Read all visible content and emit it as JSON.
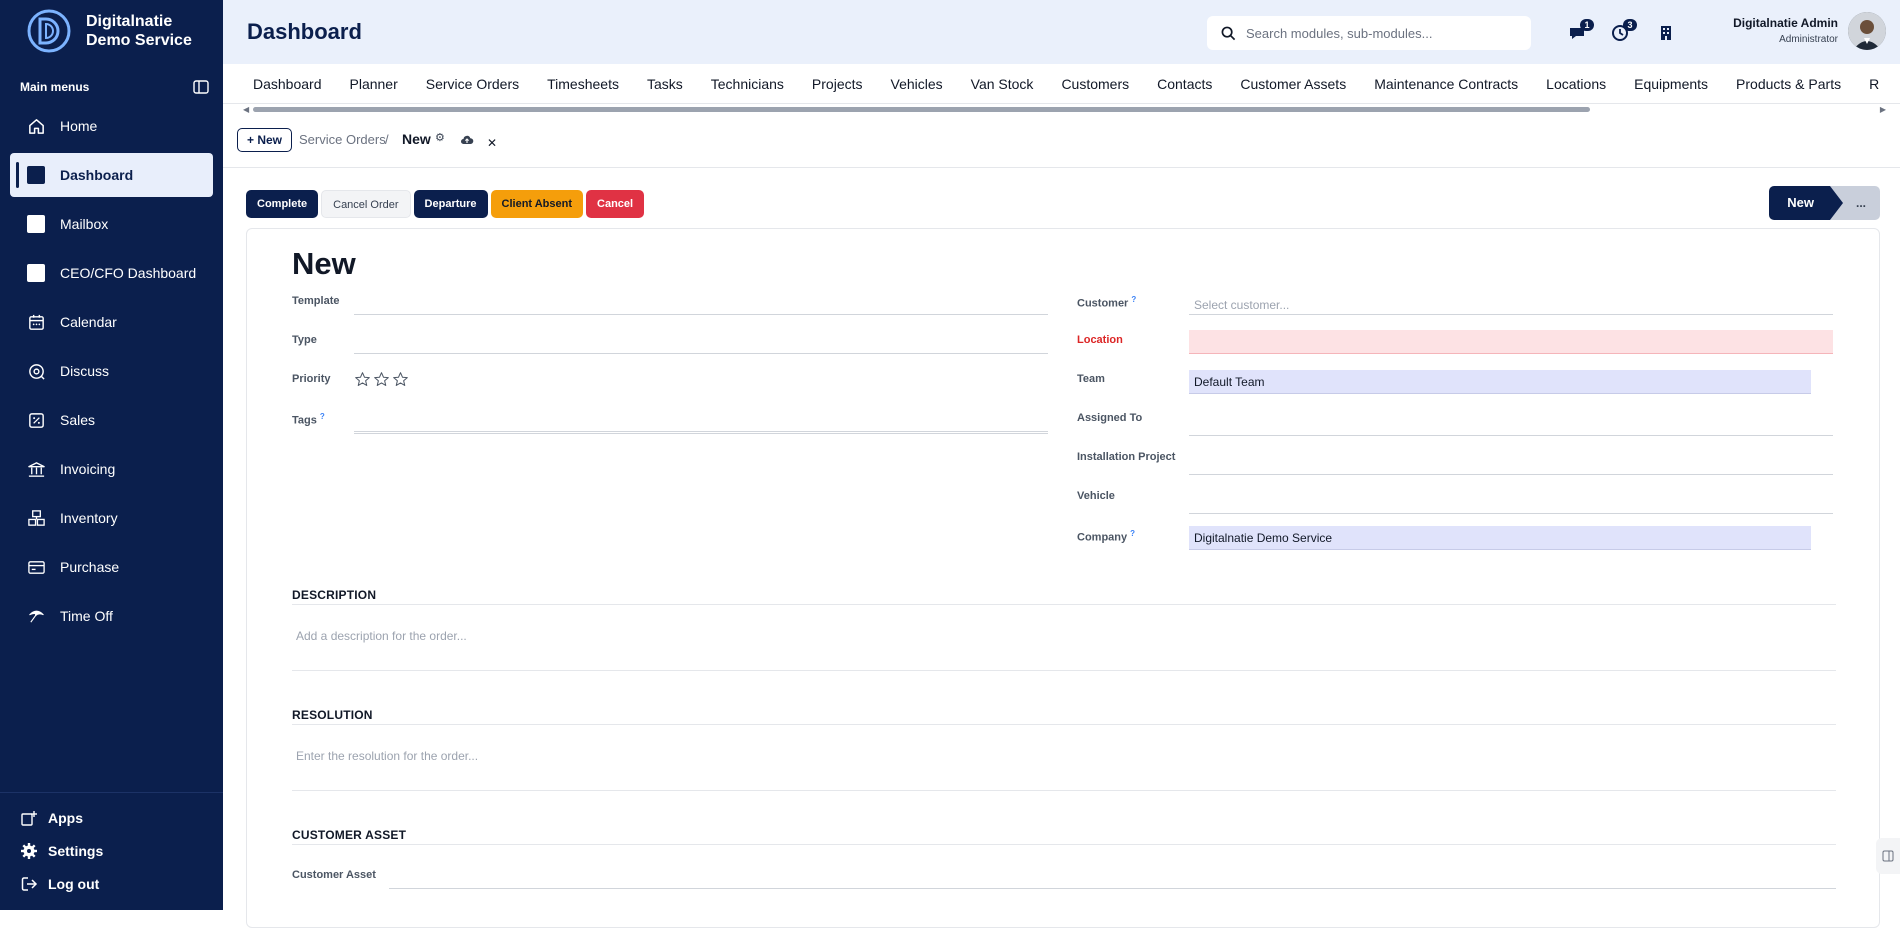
{
  "app": {
    "name": "Digitalnatie Demo Service"
  },
  "sidebar": {
    "menu_heading": "Main menus",
    "items": [
      {
        "label": "Home",
        "icon": "home-icon"
      },
      {
        "label": "Dashboard",
        "icon": "square-icon",
        "active": true
      },
      {
        "label": "Mailbox",
        "icon": "square-icon"
      },
      {
        "label": "CEO/CFO Dashboard",
        "icon": "square-icon"
      },
      {
        "label": "Calendar",
        "icon": "calendar-icon"
      },
      {
        "label": "Discuss",
        "icon": "discuss-icon"
      },
      {
        "label": "Sales",
        "icon": "sales-icon"
      },
      {
        "label": "Invoicing",
        "icon": "bank-icon"
      },
      {
        "label": "Inventory",
        "icon": "inventory-icon"
      },
      {
        "label": "Purchase",
        "icon": "card-icon"
      },
      {
        "label": "Time Off",
        "icon": "time-off-icon"
      }
    ],
    "bottom": [
      {
        "label": "Apps",
        "icon": "apps-icon"
      },
      {
        "label": "Settings",
        "icon": "gear-icon"
      },
      {
        "label": "Log out",
        "icon": "logout-icon"
      }
    ]
  },
  "header": {
    "title": "Dashboard",
    "search_placeholder": "Search modules, sub-modules...",
    "messages_count": "1",
    "activities_count": "3",
    "user_name": "Digitalnatie Admin",
    "user_role": "Administrator"
  },
  "tabs": [
    "Dashboard",
    "Planner",
    "Service Orders",
    "Timesheets",
    "Tasks",
    "Technicians",
    "Projects",
    "Vehicles",
    "Van Stock",
    "Customers",
    "Contacts",
    "Customer Assets",
    "Maintenance Contracts",
    "Locations",
    "Equipments",
    "Products & Parts",
    "R"
  ],
  "breadcrumb": {
    "new_button": "+ New",
    "parent": "Service Orders",
    "separator": "/",
    "current": "New"
  },
  "actions": {
    "complete": "Complete",
    "cancel_order": "Cancel Order",
    "departure": "Departure",
    "client_absent": "Client Absent",
    "cancel": "Cancel"
  },
  "statusbar": {
    "current": "New",
    "more": "..."
  },
  "form": {
    "title": "New",
    "left": {
      "template_label": "Template",
      "type_label": "Type",
      "priority_label": "Priority",
      "priority_stars": 0,
      "priority_max": 3,
      "tags_label": "Tags",
      "tags_help": "?"
    },
    "right": {
      "customer_label": "Customer",
      "customer_help": "?",
      "customer_placeholder": "Select customer...",
      "location_label": "Location",
      "team_label": "Team",
      "team_value": "Default Team",
      "assigned_label": "Assigned To",
      "project_label": "Installation Project",
      "vehicle_label": "Vehicle",
      "company_label": "Company",
      "company_help": "?",
      "company_value": "Digitalnatie Demo Service"
    },
    "description": {
      "heading": "DESCRIPTION",
      "placeholder": "Add a description for the order..."
    },
    "resolution": {
      "heading": "RESOLUTION",
      "placeholder": "Enter the resolution for the order..."
    },
    "customer_asset": {
      "heading": "CUSTOMER ASSET",
      "field_label": "Customer Asset"
    }
  },
  "colors": {
    "sidebar_bg": "#0b1f4d",
    "header_bg": "#eaf0fb",
    "accent": "#0b1f4d",
    "warning": "#f59e0b",
    "danger": "#e03244",
    "field_highlight": "#e0e3fb",
    "required_bg": "#fde2e4"
  }
}
